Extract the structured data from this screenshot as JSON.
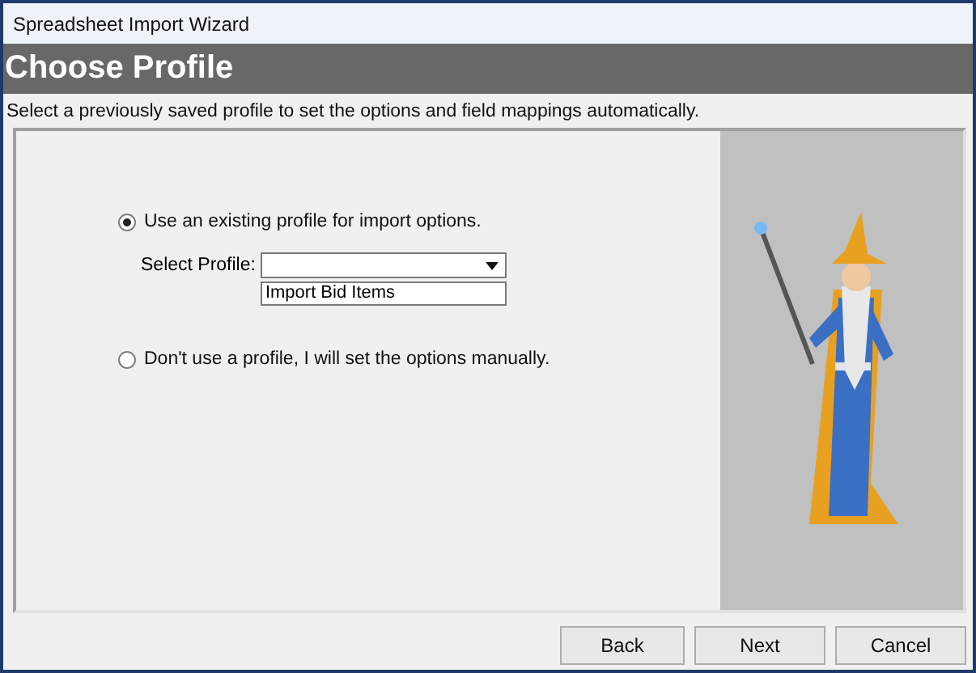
{
  "window": {
    "title": "Spreadsheet Import Wizard"
  },
  "header": {
    "title": "Choose Profile",
    "description": "Select a previously saved profile to set the options and field mappings automatically."
  },
  "options": [
    {
      "kind": "radio",
      "label": "Use an existing profile for import options.",
      "selected": true
    },
    {
      "kind": "profile_select",
      "label": "Select Profile:",
      "list_items": [
        {
          "text": "Import Bid Items",
          "selected": false
        }
      ]
    },
    {
      "kind": "radio",
      "label": "Don't use a profile, I will set the options manually.",
      "selected": false
    }
  ],
  "buttons": [
    "Back",
    "Next",
    "Cancel"
  ]
}
